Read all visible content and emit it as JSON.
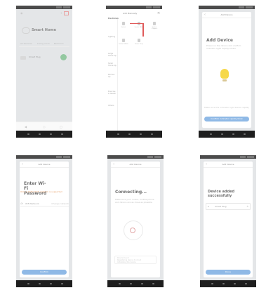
{
  "s1": {
    "home_name": "Smart Home",
    "tabs": [
      "All Devices",
      "Living room",
      "Bedroom"
    ],
    "device_name": "Smart Plug",
    "bottom_tabs": [
      "Home",
      "Smart",
      "Me"
    ]
  },
  "s2": {
    "title": "Add Manually",
    "categories": [
      "Electrician",
      "Lighting",
      "Large Home Ap.",
      "Small Home Ap.",
      "Kitchen Ap.",
      "Exercise & Health",
      "Others"
    ],
    "devices": [
      "Socket",
      "Socket (BLE)",
      "Socket (Zigbee)",
      "Socket (Wi-Fi)",
      "Power Strip",
      "Power Strip (BLE)"
    ]
  },
  "s3": {
    "title": "Add Device",
    "heading": "Add Device",
    "subtitle": "Power on the device and confirm indicator light rapidly blinks",
    "tip": "Make sure the indicator light blinks rapidly",
    "button": "Confirm indicator rapidly blink"
  },
  "s4": {
    "title": "Add Device",
    "heading": "Enter Wi-Fi Password",
    "warning": "Only 2.4GHz Wi-Fi network is supported",
    "wifi_name": "WiFi-Network",
    "change": "Change network",
    "button": "Confirm"
  },
  "s5": {
    "title": "Add Device",
    "heading": "Connecting...",
    "subtitle": "Make sure your router, mobile phone and device are as close as possible",
    "steps": [
      "Device found",
      "Registering device to cloud",
      "Initializing the device"
    ]
  },
  "s6": {
    "title": "Add Device",
    "heading": "Device added successfully",
    "device": "Smart Plug",
    "done": "Done"
  }
}
